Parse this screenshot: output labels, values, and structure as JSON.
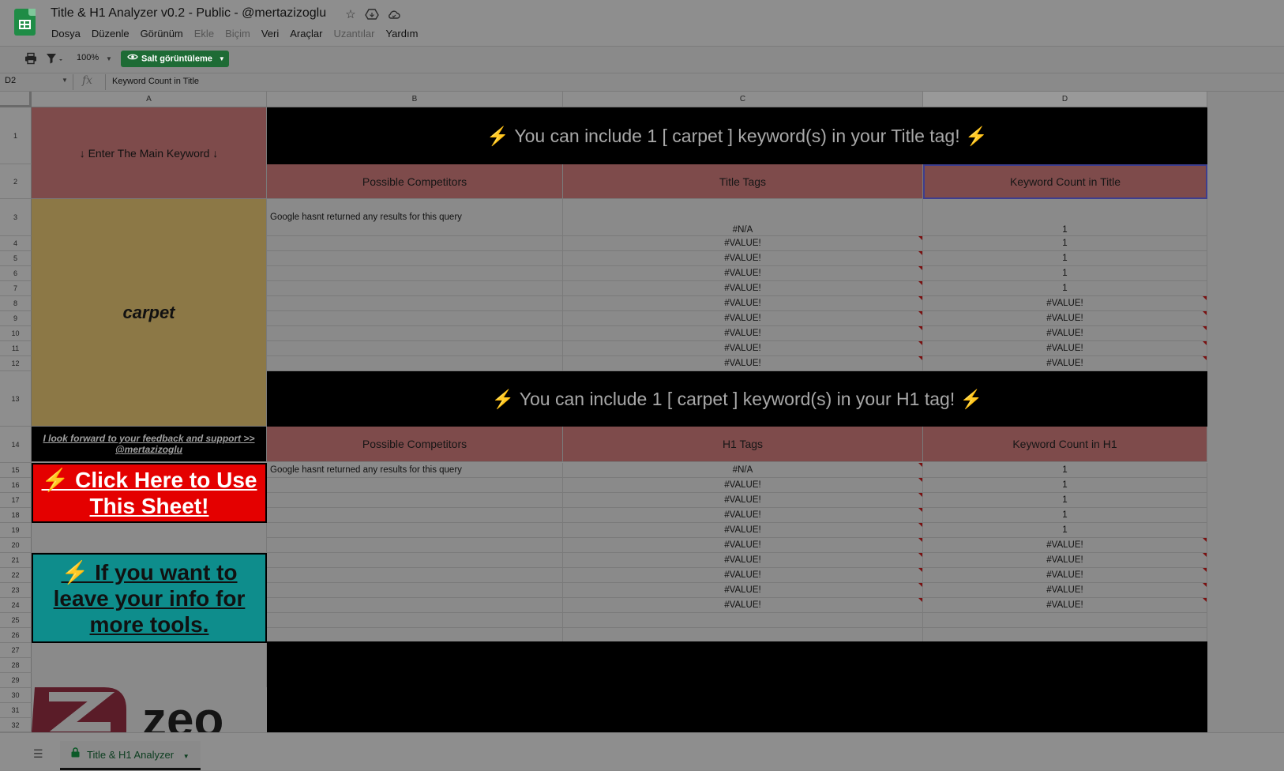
{
  "window": {
    "doc_title": "Title & H1 Analyzer v0.2 - Public - @mertazizoglu",
    "title_icons": [
      "star-icon",
      "move-to-drive-icon",
      "cloud-status-icon"
    ]
  },
  "menu": [
    "Dosya",
    "Düzenle",
    "Görünüm",
    "Ekle",
    "Biçim",
    "Veri",
    "Araçlar",
    "Uzantılar",
    "Yardım"
  ],
  "menu_disabled": [
    "Ekle",
    "Biçim",
    "Uzantılar"
  ],
  "toolbar": {
    "zoom": "100%",
    "view_only_label": "Salt görüntüleme"
  },
  "formula_bar": {
    "cell_ref": "D2",
    "fx": "fx",
    "value": "Keyword Count in Title"
  },
  "columns": [
    "A",
    "B",
    "C",
    "D"
  ],
  "rows": [
    "1",
    "2",
    "3",
    "4",
    "5",
    "6",
    "7",
    "8",
    "9",
    "10",
    "11",
    "12",
    "13",
    "14",
    "15",
    "16",
    "17",
    "18",
    "19",
    "20",
    "21",
    "22",
    "23",
    "24",
    "25",
    "26",
    "27",
    "28",
    "29",
    "30",
    "31",
    "32"
  ],
  "col_a": {
    "enter_keyword": "↓ Enter The Main Keyword ↓",
    "keyword": "carpet",
    "feedback": "I look forward to your feedback and support  >> @mertazizoglu",
    "click_here": "⚡ Click Here to Use This Sheet!",
    "leave_info": "⚡ If you want to leave your info for more tools."
  },
  "title_section": {
    "banner": "You can include 1 [ carpet ] keyword(s) in your Title tag!",
    "bolt": "⚡",
    "headers": [
      "Possible Competitors",
      "Title Tags",
      "Keyword Count in Title"
    ],
    "competitor_note": "Google hasnt returned any results for this query",
    "tags": [
      "#N/A",
      "#VALUE!",
      "#VALUE!",
      "#VALUE!",
      "#VALUE!",
      "#VALUE!",
      "#VALUE!",
      "#VALUE!",
      "#VALUE!",
      "#VALUE!"
    ],
    "counts": [
      "1",
      "1",
      "1",
      "1",
      "1",
      "#VALUE!",
      "#VALUE!",
      "#VALUE!",
      "#VALUE!",
      "#VALUE!"
    ]
  },
  "h1_section": {
    "banner": "You can include 1 [ carpet ] keyword(s) in your H1 tag!",
    "bolt": "⚡",
    "headers": [
      "Possible Competitors",
      "H1 Tags",
      "Keyword Count in H1"
    ],
    "competitor_note": "Google hasnt returned any results for this query",
    "tags": [
      "#N/A",
      "#VALUE!",
      "#VALUE!",
      "#VALUE!",
      "#VALUE!",
      "#VALUE!",
      "#VALUE!",
      "#VALUE!",
      "#VALUE!",
      "#VALUE!"
    ],
    "counts": [
      "1",
      "1",
      "1",
      "1",
      "1",
      "#VALUE!",
      "#VALUE!",
      "#VALUE!",
      "#VALUE!",
      "#VALUE!"
    ]
  },
  "logo_text": "zeo",
  "sheet_tab": "Title & H1 Analyzer",
  "colors": {
    "header_red": "#7e4b4b",
    "keyword_gold": "#8c7846",
    "cta_red": "#e40000",
    "cta_teal": "#0e8d8c",
    "banner_black": "#000000",
    "brand_green": "#1e6b35"
  }
}
